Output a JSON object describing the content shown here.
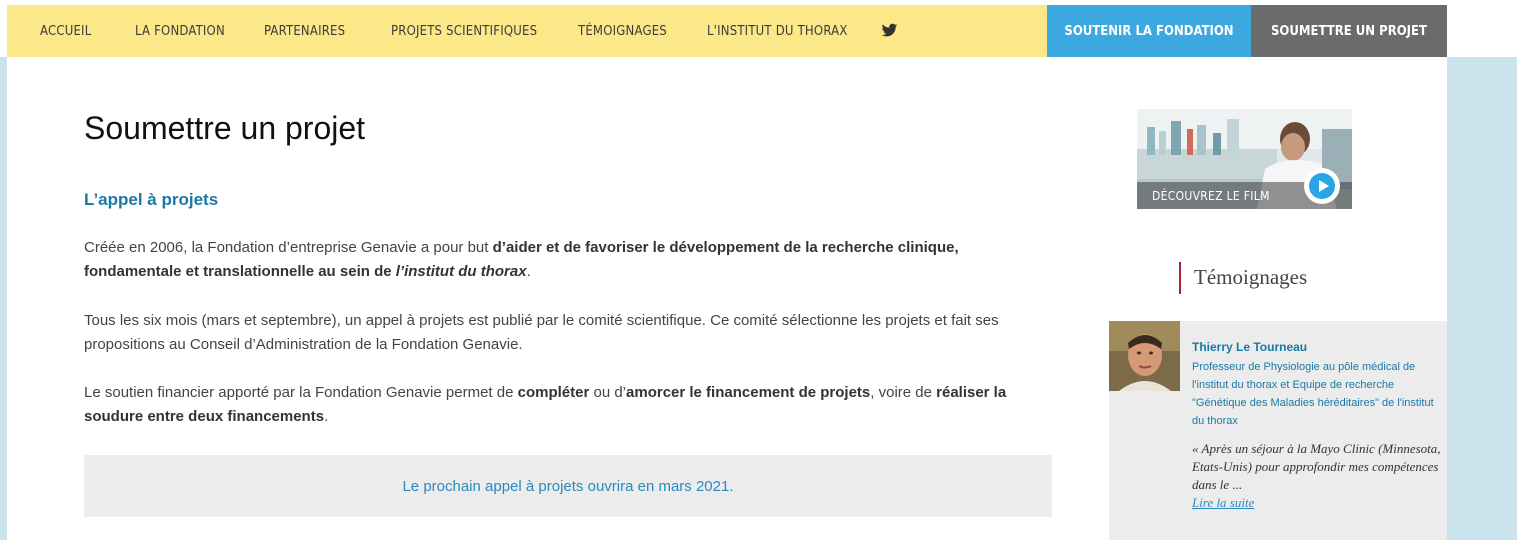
{
  "nav": {
    "items": [
      "Accueil",
      "La fondation",
      "Partenaires",
      "Projets scientifiques",
      "Témoignages",
      "L'institut du thorax"
    ],
    "twitter_icon": "twitter-icon",
    "support_button": "Soutenir la fondation",
    "submit_button": "Soumettre un projet",
    "colors": {
      "bar": "#fce789",
      "support": "#3ba8e0",
      "submit": "#6b6b6b"
    }
  },
  "main": {
    "title": "Soumettre un projet",
    "section_title": "L’appel à projets",
    "p1": {
      "t1": "Créée en 2006, la Fondation d’entreprise Genavie a pour but ",
      "b1": "d’aider et de favoriser le développement de la recherche clinique, fondamentale et translationnelle au sein de ",
      "bi": "l’institut du thorax",
      "t2": "."
    },
    "p2": "Tous les six mois (mars et septembre), un appel à projets est publié par le comité scientifique. Ce comité sélectionne les projets et fait ses propositions au Conseil d’Administration de la Fondation Genavie.",
    "p3": {
      "t1": "Le soutien financier apporté par la Fondation Genavie permet de ",
      "b1": "compléter",
      "t2": " ou d’",
      "b2": "amorcer le financement de projets",
      "t3": ", voire de ",
      "b3": "réaliser la soudure entre deux financements",
      "t4": "."
    },
    "notice": "Le prochain appel à projets ouvrira en mars 2021."
  },
  "sidebar": {
    "video_label": "DÉCOUVREZ LE FILM",
    "temoignages_title": "Témoignages",
    "testimonial": {
      "name": "Thierry Le Tourneau",
      "role": "Professeur de Physiologie au pôle médical de l'institut du thorax et Equipe de recherche \"Génétique des Maladies héréditaires\" de l'institut du thorax",
      "quote": "« Après un séjour à la Mayo Clinic (Minnesota, Etats-Unis) pour approfondir mes compétences dans le ...",
      "link": "Lire la suite"
    }
  }
}
